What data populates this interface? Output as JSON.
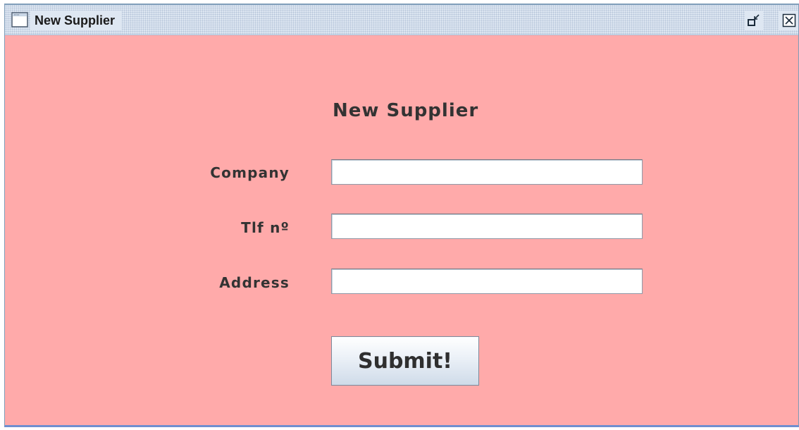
{
  "window": {
    "title": "New Supplier",
    "icon": "window-icon",
    "controls": {
      "restore_icon": "restore-icon",
      "close_icon": "close-icon"
    },
    "background_color": "#ffaaaa"
  },
  "form": {
    "heading": "New Supplier",
    "fields": [
      {
        "label": "Company",
        "value": "",
        "placeholder": ""
      },
      {
        "label": "Tlf nº",
        "value": "",
        "placeholder": ""
      },
      {
        "label": "Address",
        "value": "",
        "placeholder": ""
      }
    ],
    "submit_label": "Submit!"
  }
}
